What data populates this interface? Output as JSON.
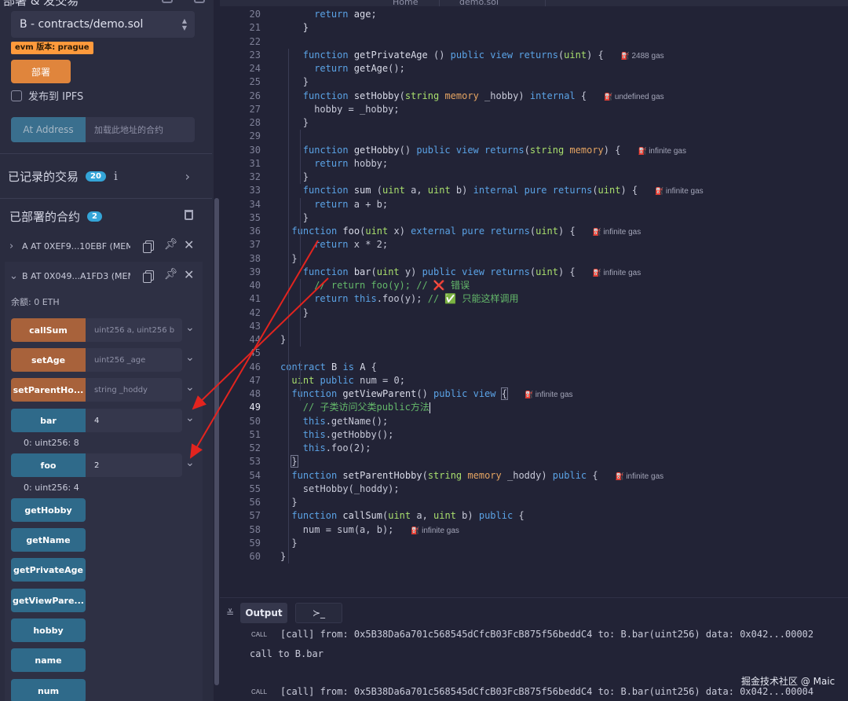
{
  "left_panel": {
    "cut_title": "部署 & 发交易",
    "contract_select": "B - contracts/demo.sol",
    "evm_badge": "evm 版本: prague",
    "deploy_label": "部署",
    "ipfs_label": "发布到 IPFS",
    "at_address_label": "At Address",
    "at_address_placeholder": "加载此地址的合约",
    "recorded_label": "已记录的交易",
    "recorded_count": "20",
    "deployed_label": "已部署的合约",
    "deployed_count": "2",
    "instances": [
      {
        "label": "A AT 0XEF9...10EBF (MEMO"
      },
      {
        "label": "B AT 0X049...A1FD3 (MEM("
      }
    ],
    "balance": "余额: 0 ETH",
    "functions": [
      {
        "name": "callSum",
        "kind": "orange",
        "input": "uint256 a, uint256 b",
        "has_input": true
      },
      {
        "name": "setAge",
        "kind": "orange",
        "input": "uint256 _age",
        "has_input": true
      },
      {
        "name": "setParentHo...",
        "kind": "orange",
        "input": "string _hoddy",
        "has_input": true
      },
      {
        "name": "bar",
        "kind": "blue",
        "input": "4",
        "has_input": true,
        "result": "0: uint256: 8"
      },
      {
        "name": "foo",
        "kind": "blue",
        "input": "2",
        "has_input": true,
        "result": "0: uint256: 4"
      },
      {
        "name": "getHobby",
        "kind": "blue"
      },
      {
        "name": "getName",
        "kind": "blue"
      },
      {
        "name": "getPrivateAge",
        "kind": "blue"
      },
      {
        "name": "getViewPare...",
        "kind": "blue"
      },
      {
        "name": "hobby",
        "kind": "blue"
      },
      {
        "name": "name",
        "kind": "blue"
      },
      {
        "name": "num",
        "kind": "blue"
      }
    ]
  },
  "editor": {
    "tabs_cut": [
      "Home",
      "demo.sol"
    ],
    "active_line": "49",
    "lines": [
      {
        "n": "20",
        "indent": 3,
        "html": "<span class=\"kw\">return</span> <span class=\"nm\">age</span>;"
      },
      {
        "n": "21",
        "indent": 2,
        "html": "<span class=\"nm\">}</span>"
      },
      {
        "n": "22",
        "indent": 0,
        "html": ""
      },
      {
        "n": "23",
        "indent": 2,
        "html": "<span class=\"kw\">function</span> <span class=\"fn\">getPrivateAge</span> () <span class=\"kw\">public view returns</span>(<span class=\"tp\">uint</span>) {",
        "gas": "2488 gas"
      },
      {
        "n": "24",
        "indent": 3,
        "html": "<span class=\"kw\">return</span> <span class=\"nm\">getAge</span>();"
      },
      {
        "n": "25",
        "indent": 2,
        "html": "}"
      },
      {
        "n": "26",
        "indent": 2,
        "html": "<span class=\"kw\">function</span> <span class=\"fn\">setHobby</span>(<span class=\"tp\">string</span> <span class=\"st\">memory</span> _hobby) <span class=\"kw\">internal</span> {",
        "gas": "undefined gas"
      },
      {
        "n": "27",
        "indent": 3,
        "html": "hobby = _hobby;"
      },
      {
        "n": "28",
        "indent": 2,
        "html": "}"
      },
      {
        "n": "29",
        "indent": 0,
        "html": ""
      },
      {
        "n": "30",
        "indent": 2,
        "html": "<span class=\"kw\">function</span> <span class=\"fn\">getHobby</span>() <span class=\"kw\">public view returns</span>(<span class=\"tp\">string</span> <span class=\"st\">memory</span>) {",
        "gas": "infinite gas"
      },
      {
        "n": "31",
        "indent": 3,
        "html": "<span class=\"kw\">return</span> hobby;"
      },
      {
        "n": "32",
        "indent": 2,
        "html": "}"
      },
      {
        "n": "33",
        "indent": 2,
        "html": "<span class=\"kw\">function</span> <span class=\"fn\">sum</span> (<span class=\"tp\">uint</span> a, <span class=\"tp\">uint</span> b) <span class=\"kw\">internal pure returns</span>(<span class=\"tp\">uint</span>) {",
        "gas": "infinite gas"
      },
      {
        "n": "34",
        "indent": 3,
        "html": "<span class=\"kw\">return</span> a + b;"
      },
      {
        "n": "35",
        "indent": 2,
        "html": "}"
      },
      {
        "n": "36",
        "indent": 1,
        "html": "<span class=\"kw\">function</span> <span class=\"fn\">foo</span>(<span class=\"tp\">uint</span> x) <span class=\"kw\">external pure returns</span>(<span class=\"tp\">uint</span>) {",
        "gas": "infinite gas"
      },
      {
        "n": "37",
        "indent": 3,
        "html": "<span class=\"kw\">return</span> x * 2;"
      },
      {
        "n": "38",
        "indent": 1,
        "html": "}"
      },
      {
        "n": "39",
        "indent": 2,
        "html": "<span class=\"kw\">function</span> <span class=\"fn\">bar</span>(<span class=\"tp\">uint</span> y) <span class=\"kw\">public view returns</span>(<span class=\"tp\">uint</span>) {",
        "gas": "infinite gas"
      },
      {
        "n": "40",
        "indent": 3,
        "html": "<span class=\"cm\">// return foo(y); // ❌ 错误</span>"
      },
      {
        "n": "41",
        "indent": 3,
        "html": "<span class=\"kw\">return</span> <span class=\"this\">this</span>.foo(y); <span class=\"cm\">// ✅ 只能这样调用</span>"
      },
      {
        "n": "42",
        "indent": 2,
        "html": "}"
      },
      {
        "n": "43",
        "indent": 0,
        "html": ""
      },
      {
        "n": "44",
        "indent": 0,
        "html": "}"
      },
      {
        "n": "45",
        "indent": 0,
        "html": ""
      },
      {
        "n": "46",
        "indent": 0,
        "html": "<span class=\"kw\">contract</span> <span class=\"fn\">B</span> <span class=\"kw\">is</span> <span class=\"fn\">A</span> {"
      },
      {
        "n": "47",
        "indent": 1,
        "html": "<span class=\"tp\">uint</span> <span class=\"kw\">public</span> num = 0;"
      },
      {
        "n": "48",
        "indent": 1,
        "html": "<span class=\"kw\">function</span> <span class=\"fn\">getViewParent</span>() <span class=\"kw\">public view</span> <span class=\"bracket-hl\">{</span>",
        "gas": "infinite gas"
      },
      {
        "n": "49",
        "indent": 2,
        "html": "<span class=\"cm\">// 子类访问父类public方法</span><span class=\"cursor\"></span>"
      },
      {
        "n": "50",
        "indent": 2,
        "html": "<span class=\"this\">this</span>.getName();"
      },
      {
        "n": "51",
        "indent": 2,
        "html": "<span class=\"this\">this</span>.getHobby();"
      },
      {
        "n": "52",
        "indent": 2,
        "html": "<span class=\"this\">this</span>.foo(2);"
      },
      {
        "n": "53",
        "indent": 1,
        "html": "<span class=\"bracket-hl\">}</span>"
      },
      {
        "n": "54",
        "indent": 1,
        "html": "<span class=\"kw\">function</span> <span class=\"fn\">setParentHobby</span>(<span class=\"tp\">string</span> <span class=\"st\">memory</span> _hoddy) <span class=\"kw\">public</span> {",
        "gas": "infinite gas"
      },
      {
        "n": "55",
        "indent": 2,
        "html": "setHobby(_hoddy);"
      },
      {
        "n": "56",
        "indent": 1,
        "html": "}"
      },
      {
        "n": "57",
        "indent": 1,
        "html": "<span class=\"kw\">function</span> <span class=\"fn\">callSum</span>(<span class=\"tp\">uint</span> a, <span class=\"tp\">uint</span> b) <span class=\"kw\">public</span> {"
      },
      {
        "n": "58",
        "indent": 2,
        "html": "num = sum(a, b);",
        "gas": "infinite gas"
      },
      {
        "n": "59",
        "indent": 1,
        "html": "}"
      },
      {
        "n": "60",
        "indent": 0,
        "html": "}"
      }
    ]
  },
  "output": {
    "tab_label": "Output",
    "terminal_glyph": "≻_",
    "logs": [
      {
        "tag": "CALL",
        "text": "[call] from: 0x5B38Da6a701c568545dCfcB03FcB875f56beddC4 to: B.bar(uint256) data: 0x042...00002"
      },
      {
        "tag": "",
        "text": "call to B.bar"
      },
      {
        "tag": "CALL",
        "text": "[call] from: 0x5B38Da6a701c568545dCfcB03FcB875f56beddC4 to: B.bar(uint256) data: 0x042...00004"
      }
    ],
    "watermark": "掘金技术社区 @ Maic"
  },
  "colors": {
    "orange_button": "#a8623b",
    "blue_button": "#2f6a8a",
    "arrow": "#e3241f"
  }
}
